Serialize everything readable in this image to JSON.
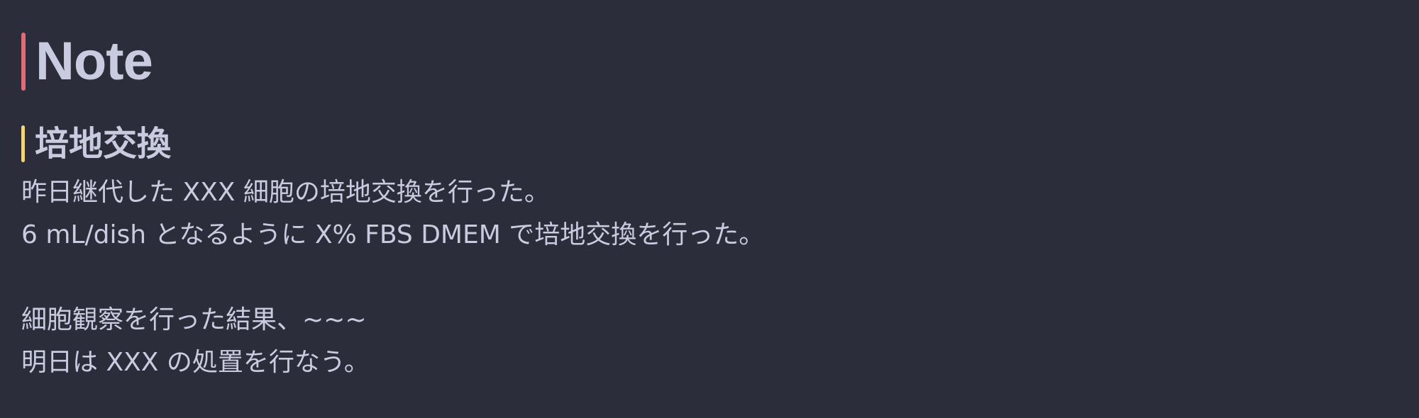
{
  "note": {
    "title": "Note",
    "section": {
      "heading": "培地交換",
      "lines": [
        "昨日継代した XXX 細胞の培地交換を行った。",
        "6 mL/dish となるように X% FBS DMEM で培地交換を行った。",
        "",
        "細胞観察を行った結果、~~~",
        "明日は XXX の処置を行なう。"
      ]
    }
  },
  "colors": {
    "background": "#2c2d3a",
    "text": "#c9cbe0",
    "h1_accent": "#e26b78",
    "h2_accent": "#f2d37e"
  }
}
